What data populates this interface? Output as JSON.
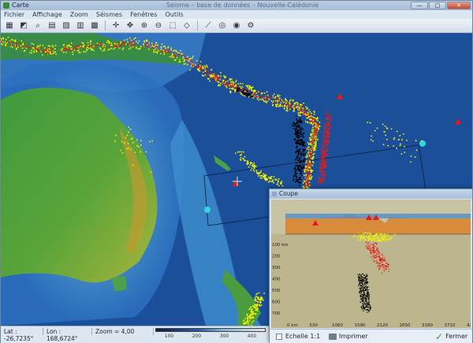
{
  "window": {
    "title": "Carte",
    "caption": "Seisme – base de données – Nouvelle-Calédonie",
    "buttons": {
      "minimize": "—",
      "maximize": "□",
      "close": "✕"
    }
  },
  "menu": [
    "Fichier",
    "Affichage",
    "Zoom",
    "Séismes",
    "Fenêtres",
    "Outils"
  ],
  "toolbar": [
    {
      "name": "open-map-icon",
      "glyph": "▦"
    },
    {
      "name": "relief-map-icon",
      "glyph": "◩"
    },
    {
      "name": "zoom-world-icon",
      "glyph": "⌕"
    },
    {
      "name": "print-map-icon",
      "glyph": "▤"
    },
    {
      "name": "layers-icon",
      "glyph": "▧"
    },
    {
      "name": "stations-icon",
      "glyph": "▥"
    },
    {
      "name": "grid-icon",
      "glyph": "▩"
    },
    {
      "name": "cursor-icon",
      "glyph": "✛"
    },
    {
      "name": "pan-icon",
      "glyph": "✥"
    },
    {
      "name": "zoom-in-icon",
      "glyph": "⊕"
    },
    {
      "name": "zoom-out-icon",
      "glyph": "⊖"
    },
    {
      "name": "zoom-box-icon",
      "glyph": "⬚"
    },
    {
      "name": "ruler-icon",
      "glyph": "◇"
    },
    {
      "name": "cross-section-icon",
      "glyph": "⟋"
    },
    {
      "name": "target-icon",
      "glyph": "◎"
    },
    {
      "name": "compass-icon",
      "glyph": "◉"
    },
    {
      "name": "gear-icon",
      "glyph": "⚙"
    }
  ],
  "status": {
    "lat": "Lat : -26,7235°",
    "lon": "Lon : 168,6724°",
    "zoom": "Zoom = 4,00",
    "scale_ticks": [
      "100",
      "200",
      "300",
      "400"
    ]
  },
  "dialog": {
    "title": "Coupe",
    "depth_labels": [
      "100 km",
      "200",
      "300",
      "400",
      "500",
      "600",
      "700"
    ],
    "distance_labels": [
      "0 km",
      "530",
      "1060",
      "1590",
      "2120",
      "2650",
      "3180",
      "3710",
      "42"
    ],
    "scale_checkbox": "Echelle 1:1",
    "print_button": "Imprimer",
    "close_button": "Fermer"
  },
  "colors": {
    "ocean_deep": "#1c4f9a",
    "ocean_mid": "#2b6fc0",
    "ocean_shallow": "#6fc5dc",
    "land_low": "#3f9a3c",
    "land_mid": "#a8b63a",
    "land_high": "#d98b3c",
    "quake_shallow": "#f2f200",
    "quake_mid": "#e41a1a",
    "quake_deep": "#000000"
  }
}
